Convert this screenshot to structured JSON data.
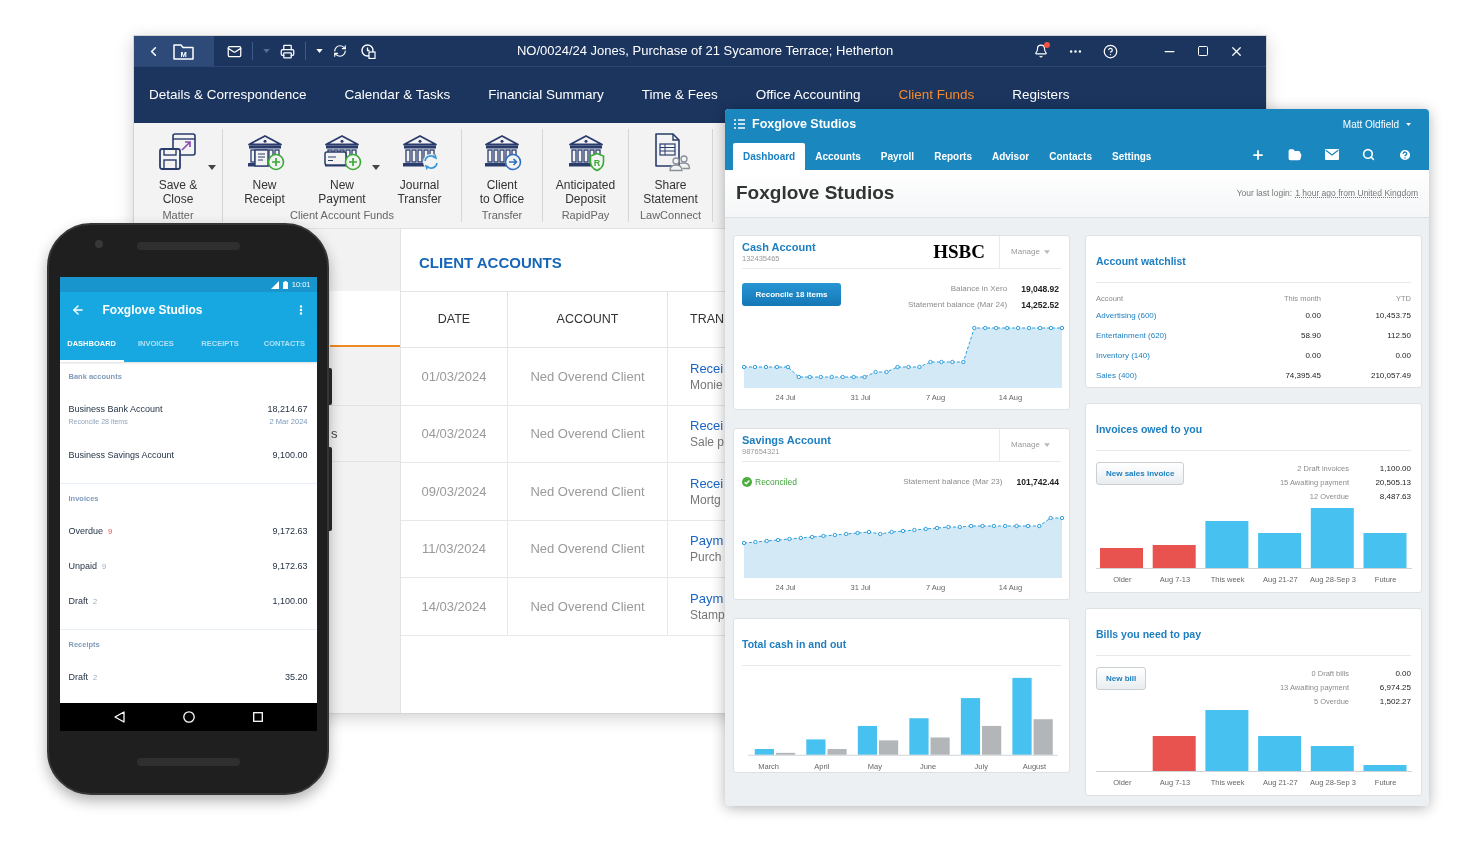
{
  "desktop_window": {
    "folder_badge": "M",
    "title": "NO/0024/24 Jones, Purchase of 21 Sycamore Terrace; Hetherton",
    "notification": true,
    "nav_tabs": [
      {
        "label": "Details & Correspondence",
        "selected": false
      },
      {
        "label": "Calendar & Tasks",
        "selected": false
      },
      {
        "label": "Financial Summary",
        "selected": false
      },
      {
        "label": "Time & Fees",
        "selected": false
      },
      {
        "label": "Office Accounting",
        "selected": false
      },
      {
        "label": "Client Funds",
        "selected": true
      },
      {
        "label": "Registers",
        "selected": false
      }
    ],
    "ribbon_groups": [
      {
        "label": "Matter",
        "buttons": [
          {
            "kind": "save",
            "label": [
              "Save &",
              "Close"
            ],
            "has_menu": true
          }
        ]
      },
      {
        "label": "Client Account Funds",
        "buttons": [
          {
            "kind": "bank_receipt",
            "label": [
              "New",
              "Receipt"
            ],
            "has_menu": false
          },
          {
            "kind": "bank_card",
            "label": [
              "New",
              "Payment"
            ],
            "has_menu": true
          },
          {
            "kind": "bank_sync",
            "label": [
              "Journal",
              "Transfer"
            ],
            "has_menu": false
          }
        ]
      },
      {
        "label": "Transfer",
        "buttons": [
          {
            "kind": "bank_arrow",
            "label": [
              "Client",
              "to Office"
            ],
            "has_menu": false
          }
        ]
      },
      {
        "label": "RapidPay",
        "buttons": [
          {
            "kind": "bank_badge",
            "badge": "R",
            "label": [
              "Anticipated",
              "Deposit"
            ],
            "has_menu": false
          }
        ]
      },
      {
        "label": "LawConnect",
        "buttons": [
          {
            "kind": "statement",
            "label": [
              "Share",
              "Statement"
            ],
            "has_menu": false
          }
        ]
      }
    ],
    "side_panel_fragment": "s",
    "client_accounts": {
      "title": "CLIENT ACCOUNTS",
      "columns": [
        "DATE",
        "ACCOUNT",
        "TRAN"
      ],
      "rows": [
        {
          "date": "01/03/2024",
          "account": "Ned Overend Client",
          "transaction": "Recei",
          "detail": "Monie"
        },
        {
          "date": "04/03/2024",
          "account": "Ned Overend Client",
          "transaction": "Recei",
          "detail": "Sale p"
        },
        {
          "date": "09/03/2024",
          "account": "Ned Overend Client",
          "transaction": "Recei",
          "detail": "Mortg"
        },
        {
          "date": "11/03/2024",
          "account": "Ned Overend Client",
          "transaction": "Paym",
          "detail": "Purch"
        },
        {
          "date": "14/03/2024",
          "account": "Ned Overend Client",
          "transaction": "Paym",
          "detail": "Stamp"
        }
      ]
    }
  },
  "phone": {
    "time": "10:01",
    "title": "Foxglove Studios",
    "tabs": [
      {
        "label": "DASHBOARD",
        "selected": true
      },
      {
        "label": "INVOICES",
        "selected": false
      },
      {
        "label": "RECEIPTS",
        "selected": false
      },
      {
        "label": "CONTACTS",
        "selected": false
      }
    ],
    "sections": [
      {
        "heading": "Bank accounts",
        "rows": [
          {
            "name": "Business Bank Account",
            "amount": "18,214.67",
            "note": "Reconcile 28 items",
            "date": "2 Mar 2024"
          },
          {
            "name": "Business Savings Account",
            "amount": "9,100.00"
          }
        ]
      },
      {
        "heading": "Invoices",
        "rows": [
          {
            "name": "Overdue",
            "count": "9",
            "alert": true,
            "amount": "9,172.63"
          },
          {
            "name": "Unpaid",
            "count": "9",
            "alert": false,
            "amount": "9,172.63"
          },
          {
            "name": "Draft",
            "count": "2",
            "alert": false,
            "amount": "1,100.00"
          }
        ]
      },
      {
        "heading": "Receipts",
        "rows": [
          {
            "name": "Draft",
            "count": "2",
            "alert": false,
            "amount": "35.20"
          }
        ]
      }
    ]
  },
  "xero_window": {
    "organisation": "Foxglove Studios",
    "user": "Matt Oldfield",
    "nav_tabs": [
      {
        "label": "Dashboard",
        "selected": true
      },
      {
        "label": "Accounts",
        "selected": false
      },
      {
        "label": "Payroll",
        "selected": false
      },
      {
        "label": "Reports",
        "selected": false
      },
      {
        "label": "Advisor",
        "selected": false
      },
      {
        "label": "Contacts",
        "selected": false
      },
      {
        "label": "Settings",
        "selected": false
      }
    ],
    "page_title": "Foxglove Studios",
    "last_login": {
      "label": "Your last login:",
      "link": "1 hour ago from United Kingdom"
    },
    "bank_accounts": [
      {
        "title": "Cash Account",
        "number": "132435465",
        "bank_logo": "HSBC",
        "manage": "Manage",
        "status": {
          "kind": "reconcile",
          "label": "Reconcile 18 items"
        },
        "balances": [
          {
            "label": "Balance in Xero",
            "value": "19,048.92"
          },
          {
            "label": "Statement balance (Mar 24)",
            "value": "14,252.52"
          }
        ],
        "x_labels": [
          "24 Jul",
          "31 Jul",
          "7 Aug",
          "14 Aug"
        ]
      },
      {
        "title": "Savings Account",
        "number": "987654321",
        "manage": "Manage",
        "status": {
          "kind": "reconciled",
          "label": "Reconciled"
        },
        "balances": [
          {
            "label": "Statement balance (Mar 23)",
            "value": "101,742.44"
          }
        ],
        "x_labels": [
          "24 Jul",
          "31 Jul",
          "7 Aug",
          "14 Aug"
        ]
      }
    ],
    "cash_flow": {
      "title": "Total cash in and out",
      "x_labels": [
        "March",
        "April",
        "May",
        "June",
        "July",
        "August"
      ]
    },
    "watchlist": {
      "title": "Account watchlist",
      "columns": [
        "Account",
        "This month",
        "YTD"
      ],
      "rows": [
        {
          "account": "Advertising (600)",
          "this_month": "0.00",
          "ytd": "10,453.75"
        },
        {
          "account": "Entertainment (620)",
          "this_month": "58.90",
          "ytd": "112.50"
        },
        {
          "account": "Inventory (140)",
          "this_month": "0.00",
          "ytd": "0.00"
        },
        {
          "account": "Sales (400)",
          "this_month": "74,395.45",
          "ytd": "210,057.49"
        }
      ]
    },
    "invoices": {
      "title": "Invoices owed to you",
      "button": "New sales invoice",
      "summary": [
        {
          "label": "2 Draft invoices",
          "value": "1,100.00"
        },
        {
          "label": "15 Awaiting payment",
          "value": "20,505.13"
        },
        {
          "label": "12 Overdue",
          "value": "8,487.63"
        }
      ],
      "x_labels": [
        "Older",
        "Aug 7-13",
        "This week",
        "Aug 21-27",
        "Aug 28-Sep 3",
        "Future"
      ]
    },
    "bills": {
      "title": "Bills you need to pay",
      "button": "New bill",
      "summary": [
        {
          "label": "0 Draft bills",
          "value": "0.00"
        },
        {
          "label": "13 Awaiting payment",
          "value": "6,974.25"
        },
        {
          "label": "5 Overdue",
          "value": "1,502.27"
        }
      ],
      "x_labels": [
        "Older",
        "Aug 7-13",
        "This week",
        "Aug 21-27",
        "Aug 28-Sep 3",
        "Future"
      ]
    }
  }
}
